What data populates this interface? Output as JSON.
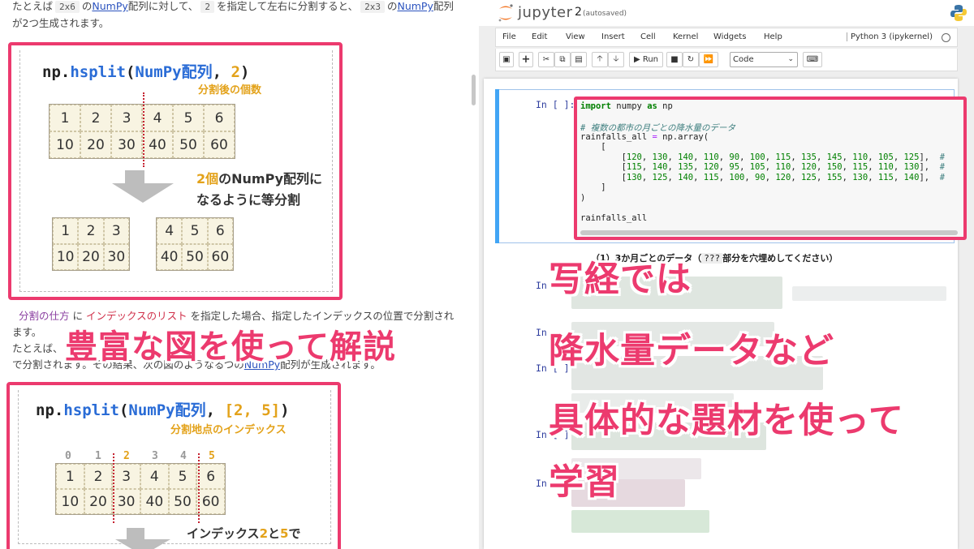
{
  "left": {
    "intro": {
      "t1": "たとえば",
      "code1": "2x6",
      "t2": "の",
      "link1": "NumPy",
      "t3": "配列に対して、",
      "code2": "2",
      "t4": "を指定して左右に分割すると、",
      "code3": "2x3",
      "t5": "の",
      "link2": "NumPy",
      "t6": "配列",
      "line2": "が2つ生成されます。"
    },
    "fig1": {
      "title_prefix": "np.",
      "title_fn": "hsplit",
      "title_open": "(",
      "title_arg1": "NumPy配列",
      "title_sep": ", ",
      "title_arg2": "2",
      "title_close": ")",
      "subtitle": "分割後の個数",
      "row1": [
        "1",
        "2",
        "3",
        "4",
        "5",
        "6"
      ],
      "row2": [
        "10",
        "20",
        "30",
        "40",
        "50",
        "60"
      ],
      "note_hl": "2個",
      "note_rest1": "のNumPy配列に",
      "note_line2": "なるように等分割",
      "left_row1": [
        "1",
        "2",
        "3"
      ],
      "left_row2": [
        "10",
        "20",
        "30"
      ],
      "right_row1": [
        "4",
        "5",
        "6"
      ],
      "right_row2": [
        "40",
        "50",
        "60"
      ]
    },
    "mid": {
      "kw1": "分割の仕方",
      "t1": "に",
      "kw2": "インデックスのリスト",
      "t2": "を指定した場合、指定したインデックスの位置で分割され",
      "line2": "ます。",
      "line3": "たとえば、",
      "line4a": "で分割されます。その結果、次の図のようなるつの",
      "line4link": "NumPy",
      "line4b": "配列が生成されます。"
    },
    "fig2": {
      "title_prefix": "np.",
      "title_fn": "hsplit",
      "title_open": "(",
      "title_arg1": "NumPy配列",
      "title_sep": ", ",
      "title_arg2": "[2, 5]",
      "title_close": ")",
      "subtitle": "分割地点のインデックス",
      "indices": [
        "0",
        "1",
        "2",
        "3",
        "4",
        "5"
      ],
      "row1": [
        "1",
        "2",
        "3",
        "4",
        "5",
        "6"
      ],
      "row2": [
        "10",
        "20",
        "30",
        "40",
        "50",
        "60"
      ],
      "note_a": "インデックス",
      "note_b": "2",
      "note_c": "と",
      "note_d": "5",
      "note_e": "で"
    }
  },
  "jupyter": {
    "brand": "jupyter",
    "notebook_name": "2",
    "save_status": "(autosaved)",
    "menu": [
      "File",
      "Edit",
      "View",
      "Insert",
      "Cell",
      "Kernel",
      "Widgets",
      "Help"
    ],
    "kernel_name": "Python 3 (ipykernel)",
    "toolbar": {
      "run_label": "Run",
      "cell_type": "Code"
    },
    "cell1": {
      "prompt": "In [ ]:",
      "code_lines": [
        "import numpy as np",
        "",
        "# 複数の都市の月ごとの降水量のデータ",
        "rainfalls_all = np.array(",
        "    [",
        "        [120, 130, 140, 110, 90, 100, 115, 135, 145, 110, 105, 125],  #",
        "        [115, 140, 135, 120, 95, 105, 110, 120, 150, 115, 110, 130],  #",
        "        [130, 125, 140, 115, 100, 90, 120, 125, 155, 130, 115, 140],  #",
        "    ]",
        ")",
        "",
        "rainfalls_all"
      ]
    },
    "markdown": {
      "prefix": "（1）3か月ごとのデータ（",
      "placeholder": "???",
      "suffix": "部分を穴埋めしてください）"
    },
    "prompts": [
      "In",
      "In",
      "In [ ]",
      "In [ ]",
      "In"
    ]
  },
  "captions": {
    "left": "豊富な図を使って解説",
    "right_lines": [
      "写経では",
      "降水量データなど",
      "具体的な題材を使って",
      "学習"
    ]
  },
  "colors": {
    "accent_pink": "#ec3a6e",
    "orange": "#e3a21a",
    "numpy_blue": "#2a6cd6",
    "jupyter_orange": "#f37726",
    "cell_border_blue": "#42a5f5"
  }
}
